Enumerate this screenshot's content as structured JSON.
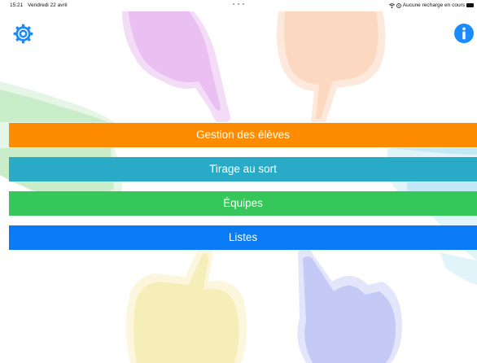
{
  "status_bar": {
    "time": "15:21",
    "date": "Vendredi 22 avril",
    "charging_text": "Aucune recharge en cours",
    "icons": [
      "wifi-icon",
      "charge-icon",
      "battery-icon"
    ]
  },
  "toolbar": {
    "settings_icon": "gear-icon",
    "info_icon": "info-icon"
  },
  "menu": {
    "items": [
      {
        "label": "Gestion des élèves",
        "color": "#ff8c00"
      },
      {
        "label": "Tirage au sort",
        "color": "#29aac7"
      },
      {
        "label": "Équipes",
        "color": "#35c759"
      },
      {
        "label": "Listes",
        "color": "#0a7af5"
      }
    ]
  },
  "colors": {
    "accent_blue": "#1a8cff",
    "background": "#ffffff"
  }
}
